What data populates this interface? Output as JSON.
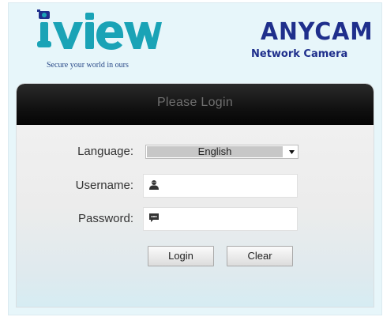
{
  "brand": {
    "tagline": "Secure your world in ours",
    "iview_wordmark": "iview",
    "anycam_wordmark": "ANYCAM",
    "anycam_subtitle": "Network Camera"
  },
  "login": {
    "title": "Please Login",
    "language_label": "Language:",
    "language_value": "English",
    "username_label": "Username:",
    "username_value": "",
    "password_label": "Password:",
    "password_value": "",
    "login_button": "Login",
    "clear_button": "Clear"
  },
  "icons": {
    "username": "user-icon",
    "password": "key-chat-icon",
    "dropdown": "chevron-down-icon"
  },
  "colors": {
    "brand_blue": "#1f2f8c",
    "iview_teal": "#1aa3b6",
    "title_bar": "#111111",
    "background": "#e7f6fa"
  }
}
